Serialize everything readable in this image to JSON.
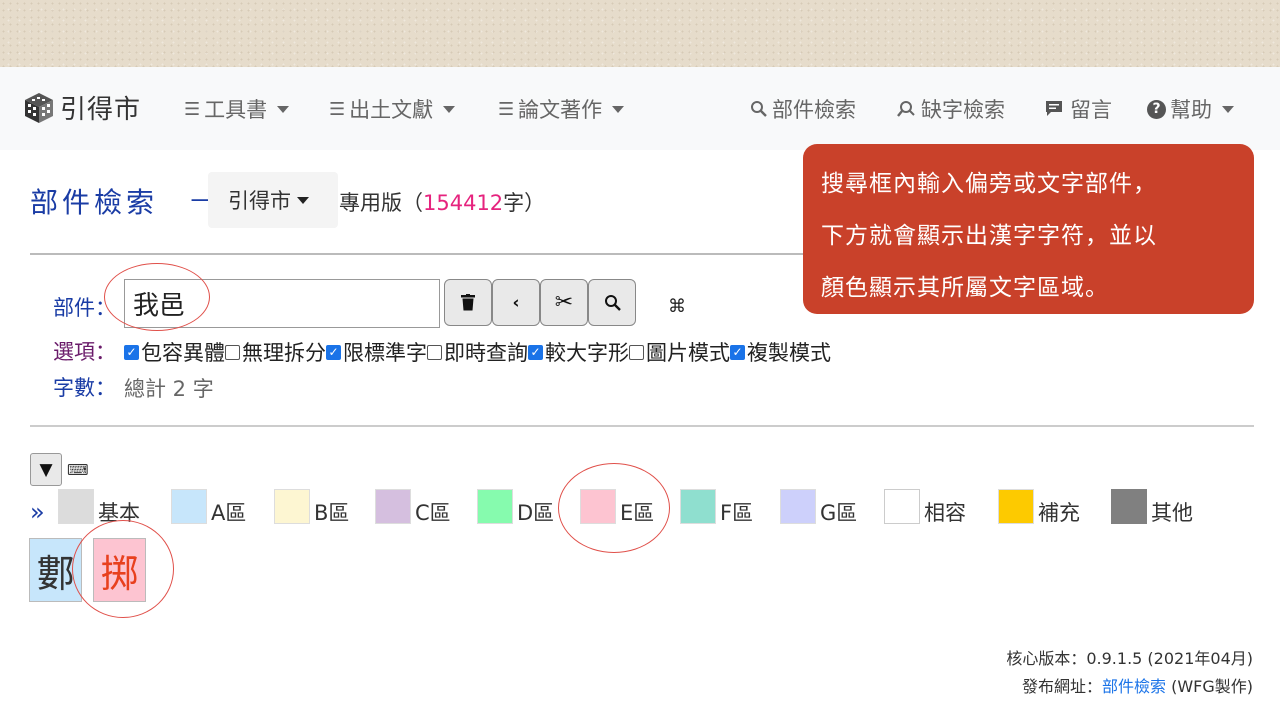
{
  "brand": {
    "name": "引得市",
    "icon": "cube-logo-icon"
  },
  "nav": {
    "left": [
      {
        "label": "工具書",
        "icon": "hamburger-icon"
      },
      {
        "label": "出土文獻",
        "icon": "hamburger-icon"
      },
      {
        "label": "論文著作",
        "icon": "hamburger-icon"
      }
    ],
    "right": [
      {
        "label": "部件檢索",
        "icon": "search-icon"
      },
      {
        "label": "缺字檢索",
        "icon": "search-alt-icon"
      },
      {
        "label": "留言",
        "icon": "comment-icon"
      },
      {
        "label": "幫助",
        "icon": "help-icon"
      }
    ]
  },
  "page": {
    "title": "部件檢索",
    "dash": "－",
    "edition_label": "引得市",
    "edition_prefix": "專用版（",
    "edition_count": "154412",
    "edition_suffix": "字）"
  },
  "search": {
    "label": "部件：",
    "value": "我邑",
    "buttons": [
      "trash-icon",
      "backspace-icon",
      "scissors-icon",
      "search-icon"
    ],
    "extra_icon": "command-icon",
    "extra_glyph": "⌘"
  },
  "options": {
    "label": "選項：",
    "items": [
      {
        "label": "包容異體",
        "checked": true
      },
      {
        "label": "無理拆分",
        "checked": false
      },
      {
        "label": "限標準字",
        "checked": true
      },
      {
        "label": "即時查詢",
        "checked": false
      },
      {
        "label": "較大字形",
        "checked": true
      },
      {
        "label": "圖片模式",
        "checked": false
      },
      {
        "label": "複製模式",
        "checked": true
      }
    ]
  },
  "count": {
    "label": "字數：",
    "value": "總計 2 字"
  },
  "legend": {
    "toggle": "▼",
    "arrow": "»",
    "items": [
      {
        "label": "基本",
        "color": "#dcdcdc"
      },
      {
        "label": "A區",
        "color": "#c7e6fb"
      },
      {
        "label": "B區",
        "color": "#fdf6d2"
      },
      {
        "label": "C區",
        "color": "#d5bfdf"
      },
      {
        "label": "D區",
        "color": "#86fbae"
      },
      {
        "label": "E區",
        "color": "#fdc4d1"
      },
      {
        "label": "F區",
        "color": "#8fdfcf"
      },
      {
        "label": "G區",
        "color": "#cdd0fb"
      },
      {
        "label": "相容",
        "color": "#ffffff"
      },
      {
        "label": "補充",
        "color": "#fdca00"
      },
      {
        "label": "其他",
        "color": "#808080"
      }
    ]
  },
  "results": [
    {
      "char": "䣚",
      "bg": "#c7e6fb",
      "fg": "#333333"
    },
    {
      "char": "掷",
      "bg": "#fdc4d1",
      "fg": "#e8401e"
    }
  ],
  "footer": {
    "version_label": "核心版本：",
    "version": "0.9.1.5 (2021年04月)",
    "url_label": "發布網址：",
    "url_link": "部件檢索",
    "url_suffix": " (WFG製作)"
  },
  "callout": {
    "line1": "搜尋框內輸入偏旁或文字部件，",
    "line2": "下方就會顯示出漢字字符，並以",
    "line3": "顏色顯示其所屬文字區域。"
  }
}
